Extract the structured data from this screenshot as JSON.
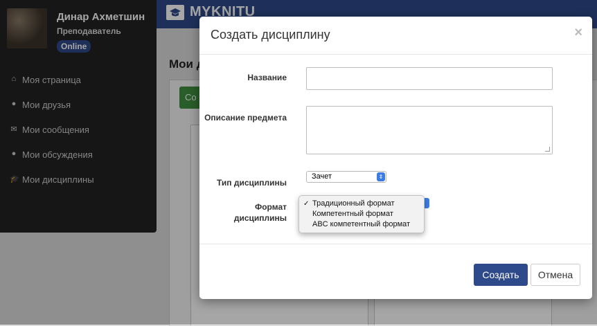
{
  "app": {
    "brand": "MYKNITU"
  },
  "user": {
    "name": "Динар Ахметшин",
    "role": "Преподаватель",
    "status": "Online"
  },
  "sidebar": {
    "items": [
      {
        "label": "Моя страница",
        "icon": "home-icon"
      },
      {
        "label": "Мои друзья",
        "icon": "user-icon"
      },
      {
        "label": "Мои сообщения",
        "icon": "envelope-icon"
      },
      {
        "label": "Мои обсуждения",
        "icon": "comments-icon"
      },
      {
        "label": "Мои дисциплины",
        "icon": "graduation-cap-icon"
      }
    ]
  },
  "main": {
    "heading_partial": "Мои д",
    "add_button_partial": "Со"
  },
  "modal": {
    "title": "Создать дисциплину",
    "close": "×",
    "fields": {
      "name_label": "Название",
      "name_value": "",
      "description_label": "Описание предмета",
      "description_value": "",
      "type_label": "Тип дисциплины",
      "type_value": "Зачет",
      "format_label_line1": "Формат",
      "format_label_line2": "дисциплины"
    },
    "format_options": [
      {
        "label": "Традиционный формат",
        "selected": true
      },
      {
        "label": "Компетентный формат",
        "selected": false
      },
      {
        "label": "ABC компетентный формат",
        "selected": false
      }
    ],
    "create_label": "Создать",
    "cancel_label": "Отмена"
  },
  "colors": {
    "primary": "#2f4a8a",
    "success": "#3f8f3f",
    "select_accent": "#3d7ce2"
  }
}
